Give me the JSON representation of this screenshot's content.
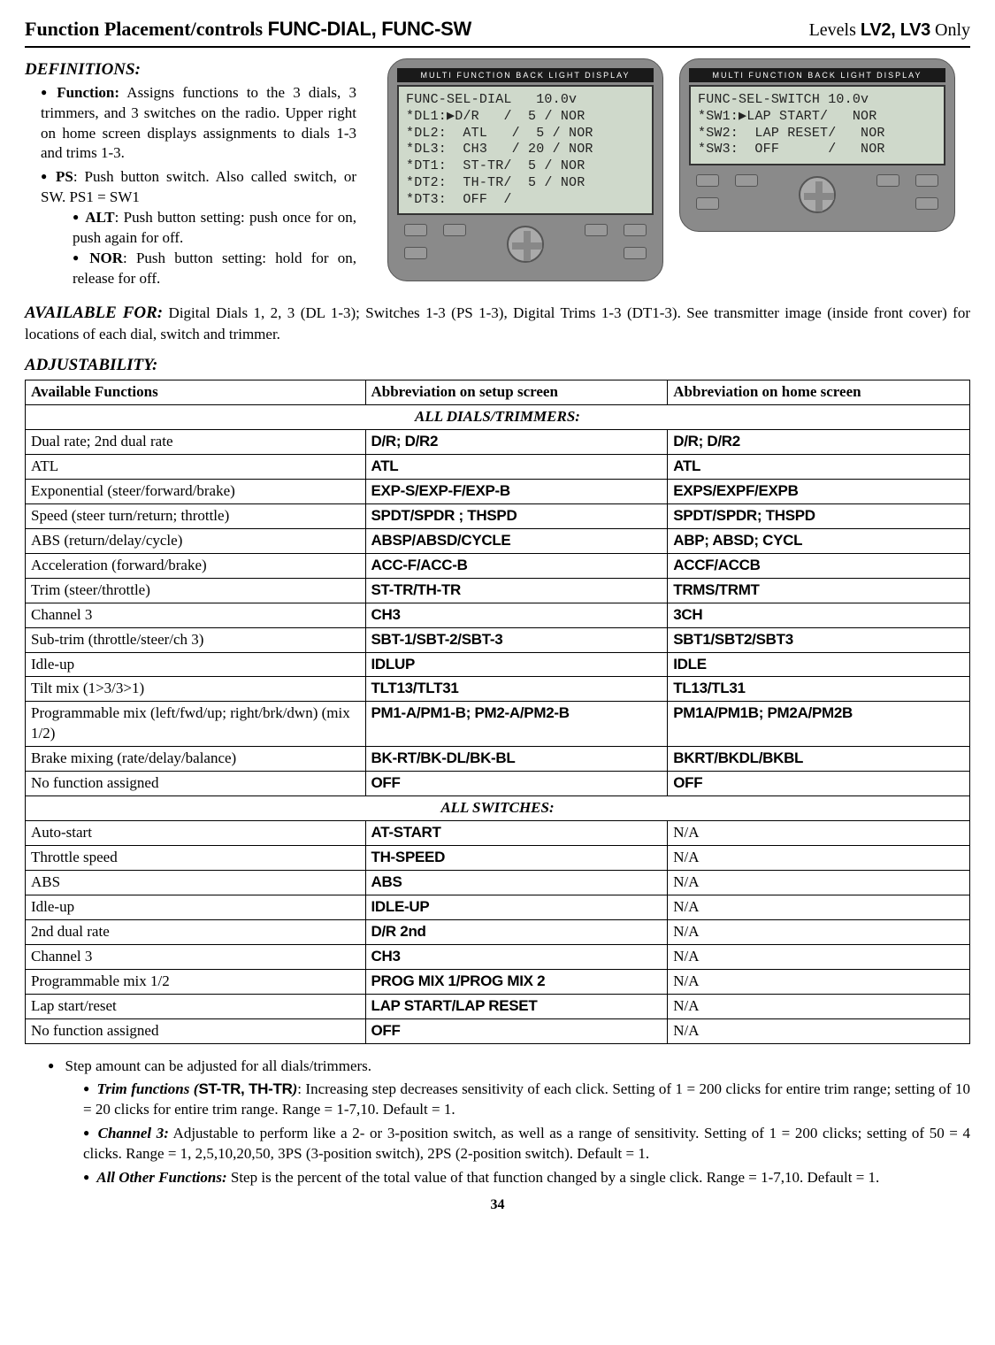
{
  "header": {
    "title_prefix": "Function Placement/controls ",
    "title_codes": "FUNC-DIAL, FUNC-SW",
    "right_prefix": "Levels ",
    "right_levels": "LV2, LV3",
    "right_suffix": " Only"
  },
  "definitions": {
    "heading": "DEFINITIONS:",
    "items": [
      {
        "label": "Function:",
        "text": " Assigns functions to the 3 dials, 3 trimmers, and 3 switches on the radio. Upper right on home screen displays assignments to dials 1-3 and trims 1-3."
      },
      {
        "label": "PS",
        "text": ": Push button switch. Also called switch, or SW. PS1 = SW1",
        "sub": [
          {
            "label": "ALT",
            "text": ": Push button setting: push once for on, push again for off."
          },
          {
            "label": "NOR",
            "text": ": Push button setting: hold for on, release for off."
          }
        ]
      }
    ]
  },
  "devices": {
    "strip": "MULTI  FUNCTION  BACK  LIGHT  DISPLAY",
    "left_lcd": "FUNC-SEL-DIAL   10.0v\n*DL1:▶D/R   /  5 / NOR\n*DL2:  ATL   /  5 / NOR\n*DL3:  CH3   / 20 / NOR\n*DT1:  ST-TR/  5 / NOR\n*DT2:  TH-TR/  5 / NOR\n*DT3:  OFF  /",
    "right_lcd": "FUNC-SEL-SWITCH 10.0v\n*SW1:▶LAP START/   NOR\n*SW2:  LAP RESET/   NOR\n*SW3:  OFF      /   NOR"
  },
  "available_for": {
    "heading": "AVAILABLE FOR:",
    "text": " Digital Dials 1, 2, 3 (DL 1-3); Switches 1-3 (PS 1-3), Digital Trims 1-3 (DT1-3). See transmitter image (inside front cover) for locations of each dial, switch and trimmer."
  },
  "adjustability": {
    "heading": "ADJUSTABILITY:",
    "cols": [
      "Available Functions",
      "Abbreviation on setup screen",
      "Abbreviation on home screen"
    ],
    "section1": "ALL DIALS/TRIMMERS:",
    "rows1": [
      [
        "Dual rate; 2nd dual rate",
        "D/R; D/R2",
        "D/R; D/R2"
      ],
      [
        "ATL",
        "ATL",
        "ATL"
      ],
      [
        "Exponential (steer/forward/brake)",
        "EXP-S/EXP-F/EXP-B",
        "EXPS/EXPF/EXPB"
      ],
      [
        "Speed (steer turn/return; throttle)",
        "SPDT/SPDR ; THSPD",
        "SPDT/SPDR; THSPD"
      ],
      [
        "ABS (return/delay/cycle)",
        "ABSP/ABSD/CYCLE",
        "ABP; ABSD; CYCL"
      ],
      [
        "Acceleration (forward/brake)",
        "ACC-F/ACC-B",
        "ACCF/ACCB"
      ],
      [
        "Trim (steer/throttle)",
        "ST-TR/TH-TR",
        "TRMS/TRMT"
      ],
      [
        "Channel 3",
        "CH3",
        "3CH"
      ],
      [
        "Sub-trim (throttle/steer/ch 3)",
        "SBT-1/SBT-2/SBT-3",
        "SBT1/SBT2/SBT3"
      ],
      [
        "Idle-up",
        "IDLUP",
        "IDLE"
      ],
      [
        "Tilt mix (1>3/3>1)",
        "TLT13/TLT31",
        "TL13/TL31"
      ],
      [
        "Programmable mix (left/fwd/up; right/brk/dwn) (mix 1/2)",
        "PM1-A/PM1-B; PM2-A/PM2-B",
        "PM1A/PM1B; PM2A/PM2B"
      ],
      [
        "Brake mixing (rate/delay/balance)",
        "BK-RT/BK-DL/BK-BL",
        "BKRT/BKDL/BKBL"
      ],
      [
        "No function assigned",
        "OFF",
        "OFF"
      ]
    ],
    "section2": "ALL SWITCHES:",
    "rows2": [
      [
        "Auto-start",
        "AT-START",
        "N/A"
      ],
      [
        "Throttle speed",
        "TH-SPEED",
        "N/A"
      ],
      [
        "ABS",
        "ABS",
        "N/A"
      ],
      [
        "Idle-up",
        "IDLE-UP",
        "N/A"
      ],
      [
        "2nd dual rate",
        "D/R 2nd",
        "N/A"
      ],
      [
        "Channel 3",
        "CH3",
        "N/A"
      ],
      [
        "Programmable mix 1/2",
        "PROG MIX 1/PROG MIX 2",
        "N/A"
      ],
      [
        "Lap start/reset",
        "LAP START/LAP RESET",
        "N/A"
      ],
      [
        "No function assigned",
        "OFF",
        "N/A"
      ]
    ]
  },
  "notes": {
    "lead": "Step amount can be adjusted for all dials/trimmers.",
    "items": [
      {
        "label_i": "Trim functions (",
        "label_b": "ST-TR, TH-TR",
        "label_i2": ")",
        "text": ": Increasing step decreases sensitivity of each click. Setting of 1 = 200 clicks for entire trim range; setting of 10 = 20 clicks for entire trim range. Range = 1-7,10. Default = 1."
      },
      {
        "label_i": "Channel 3:",
        "label_b": "",
        "label_i2": "",
        "text": " Adjustable to perform like a 2- or 3-position switch, as well as a range of sensitivity. Setting of 1 = 200 clicks; setting of 50 = 4 clicks. Range = 1, 2,5,10,20,50, 3PS (3-position switch), 2PS (2-position switch). Default = 1."
      },
      {
        "label_i": "All Other Functions:",
        "label_b": "",
        "label_i2": "",
        "text": " Step is the percent of the total value of that function changed by a single click. Range = 1-7,10. Default = 1."
      }
    ]
  },
  "page_number": "34"
}
